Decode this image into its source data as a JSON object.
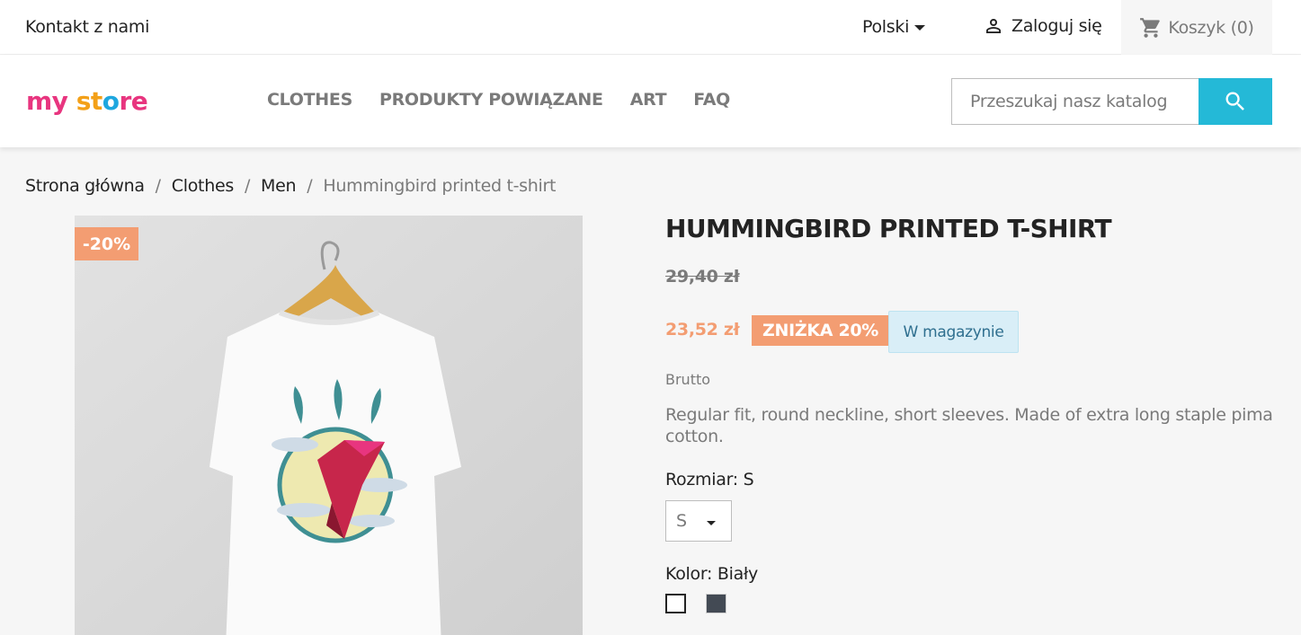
{
  "topbar": {
    "contact_label": "Kontakt z nami",
    "language_label": "Polski",
    "login_label": "Zaloguj się",
    "cart_label": "Koszyk (0)"
  },
  "header": {
    "logo_parts": [
      "my",
      " ",
      "st",
      "o",
      "re"
    ],
    "nav": [
      {
        "label": "CLOTHES"
      },
      {
        "label": "PRODUKTY POWIĄZANE"
      },
      {
        "label": "ART"
      },
      {
        "label": "FAQ"
      }
    ],
    "search_placeholder": "Przeszukaj nasz katalog"
  },
  "breadcrumb": {
    "items": [
      "Strona główna",
      "Clothes",
      "Men"
    ],
    "current": "Hummingbird printed t-shirt",
    "separator": "/"
  },
  "product": {
    "image_flag": "-20%",
    "title": "HUMMINGBIRD PRINTED T-SHIRT",
    "regular_price": "29,40 zł",
    "current_price": "23,52 zł",
    "discount_label": "ZNIŻKA 20%",
    "stock_label": "W magazynie",
    "tax_label": "Brutto",
    "description": "Regular fit, round neckline, short sleeves. Made of extra long staple pima cotton.",
    "size_label": "Rozmiar: S",
    "size_value": "S",
    "color_label": "Kolor: Biały",
    "colors": [
      "#ffffff",
      "#434a54"
    ]
  },
  "colors": {
    "accent": "#24b9d7",
    "discount": "#f39d72",
    "stock_bg": "#d9eef7"
  }
}
